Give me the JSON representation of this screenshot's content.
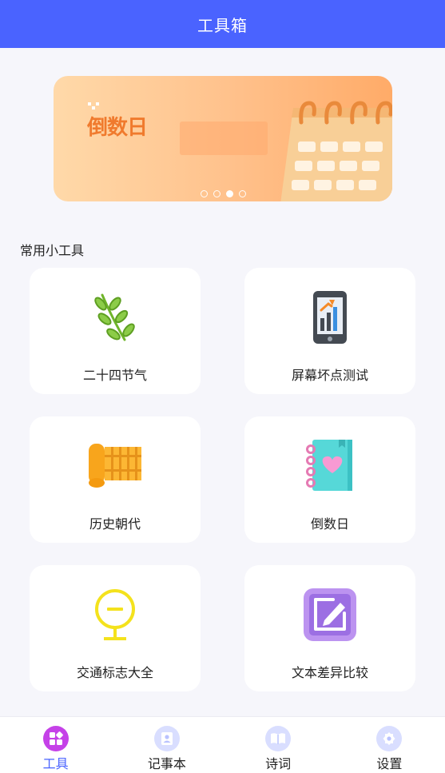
{
  "header": {
    "title": "工具箱"
  },
  "banner": {
    "logo_text": "倒数日",
    "carousel_total": 4,
    "carousel_active_index": 3
  },
  "section": {
    "title": "常用小工具"
  },
  "tools": [
    {
      "label": "二十四节气",
      "icon": "leaf-branch-icon"
    },
    {
      "label": "屏幕坏点测试",
      "icon": "phone-chart-icon"
    },
    {
      "label": "历史朝代",
      "icon": "bamboo-scroll-icon"
    },
    {
      "label": "倒数日",
      "icon": "heart-notebook-icon"
    },
    {
      "label": "交通标志大全",
      "icon": "traffic-sign-icon"
    },
    {
      "label": "文本差异比较",
      "icon": "edit-note-icon"
    }
  ],
  "tabbar": {
    "items": [
      {
        "label": "工具",
        "icon": "grid-icon",
        "active": true
      },
      {
        "label": "记事本",
        "icon": "contact-book-icon",
        "active": false
      },
      {
        "label": "诗词",
        "icon": "open-book-icon",
        "active": false
      },
      {
        "label": "设置",
        "icon": "gear-icon",
        "active": false
      }
    ]
  },
  "colors": {
    "primary": "#4a63ff",
    "active_tab_icon": "#c541e8",
    "inactive_tab_icon": "#d9deff",
    "page_background": "#f6f6fb"
  }
}
